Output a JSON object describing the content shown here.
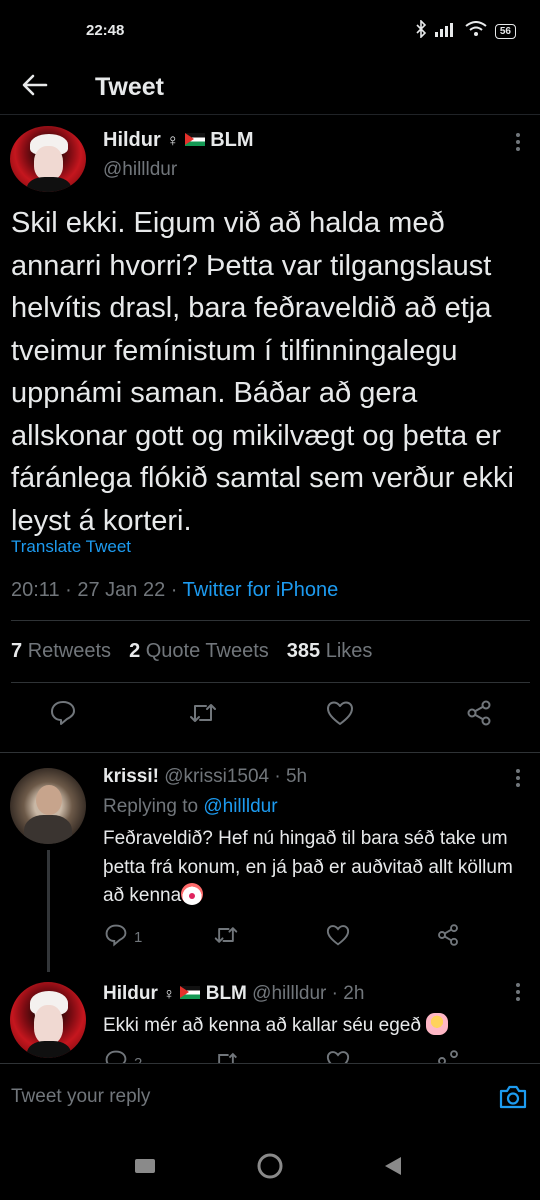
{
  "status_bar": {
    "time": "22:48",
    "battery": "56"
  },
  "header": {
    "title": "Tweet"
  },
  "tweet": {
    "author_name": "Hildur",
    "author_suffix": "BLM",
    "author_handle": "@hillldur",
    "text": "Skil ekki. Eigum við að halda með annarri hvorri? Þetta var tilgangslaust helvítis drasl, bara feðraveldið að etja tveimur femínistum í tilfinningalegu uppnámi saman. Báðar að gera allskonar gott og mikilvægt og þetta er fáránlega flókið samtal sem verður ekki leyst á korteri.",
    "translate_label": "Translate Tweet",
    "time": "20:11",
    "date": "27 Jan 22",
    "client": "Twitter for iPhone",
    "stats": {
      "retweets_count": "7",
      "retweets_label": "Retweets",
      "quotes_count": "2",
      "quotes_label": "Quote Tweets",
      "likes_count": "385",
      "likes_label": "Likes"
    }
  },
  "replies": [
    {
      "name": "krissi!",
      "handle": "@krissi1504",
      "age": "5h",
      "replying_prefix": "Replying to",
      "replying_to": "@hillldur",
      "text": "Feðraveldið? Hef nú hingað til bara séð take um þetta frá konum, en já það er auðvitað allt köllum að kenna",
      "reply_count": "1"
    },
    {
      "name": "Hildur",
      "suffix": "BLM",
      "handle": "@hillldur",
      "age": "2h",
      "text": "Ekki mér að kenna að kallar séu egeð",
      "reply_count": "2"
    }
  ],
  "compose": {
    "placeholder": "Tweet your reply"
  },
  "colors": {
    "background": "#000000",
    "accent": "#1d9bf0",
    "secondary_text": "#71767b"
  }
}
